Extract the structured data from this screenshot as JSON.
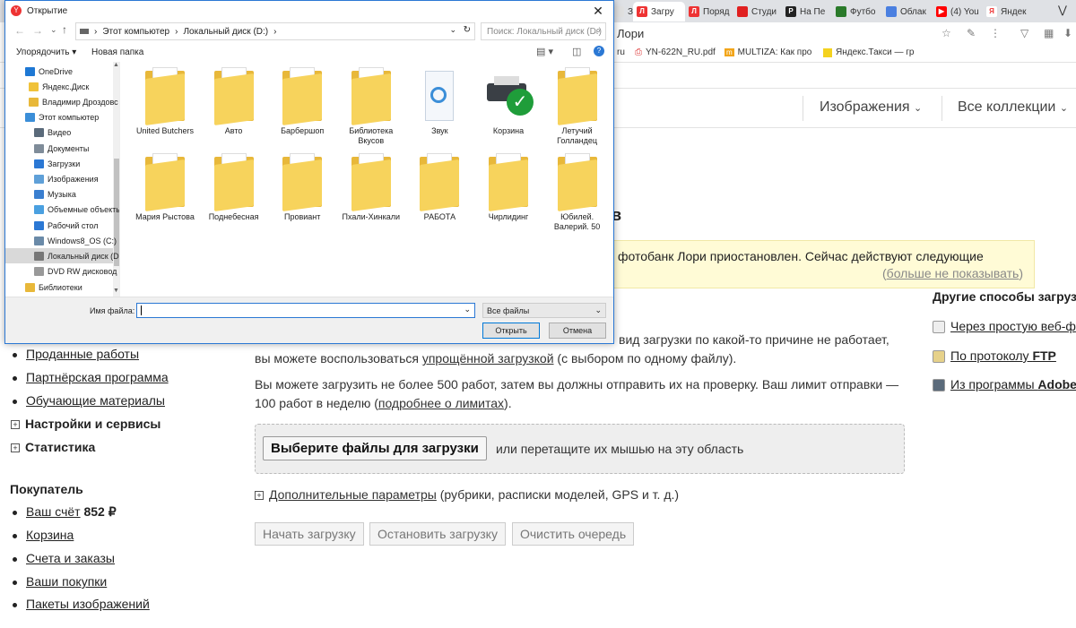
{
  "browser": {
    "tabs": [
      {
        "label": "Запо",
        "color": "#e0e0e0",
        "glyph": ""
      },
      {
        "label": "Загру",
        "color": "#e33",
        "glyph": "Л",
        "active": true
      },
      {
        "label": "Поряд",
        "color": "#e33",
        "glyph": "Л"
      },
      {
        "label": "Студи",
        "color": "#e02020",
        "glyph": ""
      },
      {
        "label": "На Пе",
        "color": "#222",
        "glyph": "P"
      },
      {
        "label": "Футбо",
        "color": "#2a7a2a",
        "glyph": ""
      },
      {
        "label": "Облак",
        "color": "#4a7fe0",
        "glyph": ""
      },
      {
        "label": "(4) You",
        "color": "#f00",
        "glyph": "▶"
      },
      {
        "label": "Яндек",
        "color": "#fff",
        "glyph": "Я"
      }
    ],
    "address_fragment": "Лори",
    "bookmarks": {
      "b1": "ru",
      "b2": "YN-622N_RU.pdf",
      "b3": "MULTIZA: Как про",
      "b4": "Яндекс.Такси — гр"
    }
  },
  "navbar": {
    "images": "Изображения",
    "collections": "Все коллекции"
  },
  "notice": {
    "partial_heading": "в",
    "text": "фотобанк Лори приостановлен. Сейчас действуют следующие",
    "dismiss": "больше не показывать"
  },
  "right_panel": {
    "title": "Другие способы загруз",
    "items": [
      {
        "text": "Через простую веб-ф",
        "bold": ""
      },
      {
        "text": "По протоколу ",
        "bold": "FTP"
      },
      {
        "text": "Из программы ",
        "bold": "Adobe"
      }
    ]
  },
  "main": {
    "p1_a": "вид загрузки по какой-то причине не работает,",
    "p1_b": "вы можете воспользоваться ",
    "p1_link": "упрощённой загрузкой",
    "p1_c": " (с выбором по одному файлу).",
    "p2_a": "Вы можете загрузить не более 500 работ, затем вы должны отправить их на проверку. Ваш лимит отправки —",
    "p2_b": "100 работ в неделю (",
    "p2_link": "подробнее о лимитах",
    "p2_c": ").",
    "choose_button": "Выберите файлы для загрузки",
    "drop_hint": "или перетащите их мышью на эту область",
    "advanced_link": "Дополнительные параметры",
    "advanced_hint": " (рубрики, расписки моделей, GPS и т. д.)",
    "start": "Начать загрузку",
    "stop": "Остановить загрузку",
    "clear": "Очистить очередь"
  },
  "left_menu": {
    "sold": "Проданные работы",
    "partner": "Партнёрская программа",
    "edu": "Обучающие материалы",
    "settings": "Настройки и сервисы",
    "stats": "Статистика",
    "buyer_heading": "Покупатель",
    "account": "Ваш счёт",
    "account_sum": "852 ₽",
    "cart": "Корзина",
    "invoices": "Счета и заказы",
    "purchases": "Ваши покупки",
    "packs": "Пакеты изображений"
  },
  "dialog": {
    "title": "Открытие",
    "breadcrumb": [
      "Этот компьютер",
      "Локальный диск (D:)"
    ],
    "search_placeholder": "Поиск: Локальный диск (D:)",
    "organize": "Упорядочить ▾",
    "new_folder": "Новая папка",
    "nav": [
      {
        "label": "OneDrive",
        "color": "#1e78d4"
      },
      {
        "label": "Яндекс.Диск",
        "color": "#f0c23a"
      },
      {
        "label": "Владимир Дроздовс",
        "color": "#e8b83a"
      },
      {
        "label": "Этот компьютер",
        "color": "#3b8ed8"
      },
      {
        "label": "Видео",
        "color": "#5a6a7a"
      },
      {
        "label": "Документы",
        "color": "#7f8c99"
      },
      {
        "label": "Загрузки",
        "color": "#2b78d4"
      },
      {
        "label": "Изображения",
        "color": "#5fa0d8"
      },
      {
        "label": "Музыка",
        "color": "#3a7fd0"
      },
      {
        "label": "Объемные объекты",
        "color": "#4aa0e0"
      },
      {
        "label": "Рабочий стол",
        "color": "#2b78d4"
      },
      {
        "label": "Windows8_OS (C:)",
        "color": "#6a8aa8"
      },
      {
        "label": "Локальный диск (D",
        "color": "#777",
        "selected": true
      },
      {
        "label": "DVD RW дисковод (",
        "color": "#999"
      },
      {
        "label": "Библиотеки",
        "color": "#e8b83a"
      }
    ],
    "files": [
      {
        "label": "United Butchers",
        "kind": "folder"
      },
      {
        "label": "Авто",
        "kind": "folder"
      },
      {
        "label": "Барбершоп",
        "kind": "folder"
      },
      {
        "label": "Библиотека Вкусов",
        "kind": "folder"
      },
      {
        "label": "Звук",
        "kind": "sound"
      },
      {
        "label": "Корзина",
        "kind": "printer"
      },
      {
        "label": "Летучий Голландец",
        "kind": "folder"
      },
      {
        "label": "Мария Рыстова",
        "kind": "folder"
      },
      {
        "label": "Поднебесная",
        "kind": "folder"
      },
      {
        "label": "Провиант",
        "kind": "folder"
      },
      {
        "label": "Пхали-Хинкали",
        "kind": "folder"
      },
      {
        "label": "РАБОТА",
        "kind": "folder"
      },
      {
        "label": "Чирлидинг",
        "kind": "folder"
      },
      {
        "label": "Юбилей. Валерий. 50",
        "kind": "folder"
      }
    ],
    "filename_label": "Имя файла:",
    "filename_value": "",
    "filetype": "Все файлы",
    "open": "Открыть",
    "cancel": "Отмена"
  }
}
